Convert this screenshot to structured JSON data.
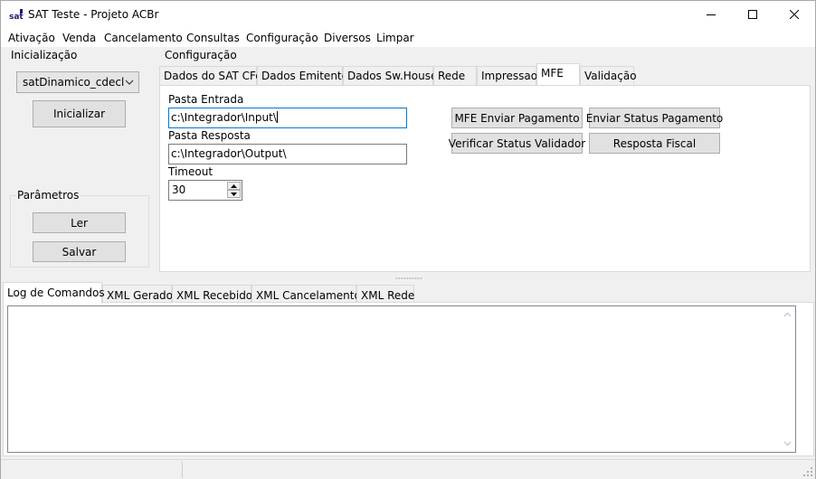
{
  "window": {
    "title": "SAT Teste - Projeto ACBr",
    "icon": "sat-app-icon",
    "controls": {
      "minimize": "minimize-icon",
      "maximize": "maximize-icon",
      "close": "close-icon"
    }
  },
  "menu": [
    "Ativação",
    "Venda",
    "Cancelamento",
    "Consultas",
    "Configuração",
    "Diversos",
    "Limpar"
  ],
  "inicializacao": {
    "label": "Inicialização",
    "model_select": "satDinamico_cdecl",
    "init_button": "Inicializar"
  },
  "parametros": {
    "label": "Parâmetros",
    "read_button": "Ler",
    "save_button": "Salvar"
  },
  "configuracao": {
    "label": "Configuração",
    "tabs": [
      "Dados do SAT CFe",
      "Dados Emitente",
      "Dados Sw.House",
      "Rede",
      "Impressao",
      "MFE",
      "Validação"
    ],
    "active_tab": "MFE",
    "mfe": {
      "input_folder_label": "Pasta Entrada",
      "input_folder_value": "c:\\Integrador\\Input\\",
      "response_folder_label": "Pasta Resposta",
      "response_folder_value": "c:\\Integrador\\Output\\",
      "timeout_label": "Timeout",
      "timeout_value": "30",
      "buttons": {
        "enviar_pagamento": "MFE Enviar Pagamento",
        "enviar_status": "Enviar Status Pagamento",
        "verificar_status": "Verificar Status Validador",
        "resposta_fiscal": "Resposta Fiscal"
      }
    }
  },
  "log": {
    "tabs": [
      "Log de Comandos",
      "XML Gerado",
      "XML Recebido",
      "XML Cancelamento",
      "XML Rede"
    ],
    "active_tab": "Log de Comandos",
    "content": ""
  },
  "colors": {
    "focus_border": "#0078d7",
    "button_face": "#e1e1e1",
    "window_bg": "#f0f0f0"
  }
}
